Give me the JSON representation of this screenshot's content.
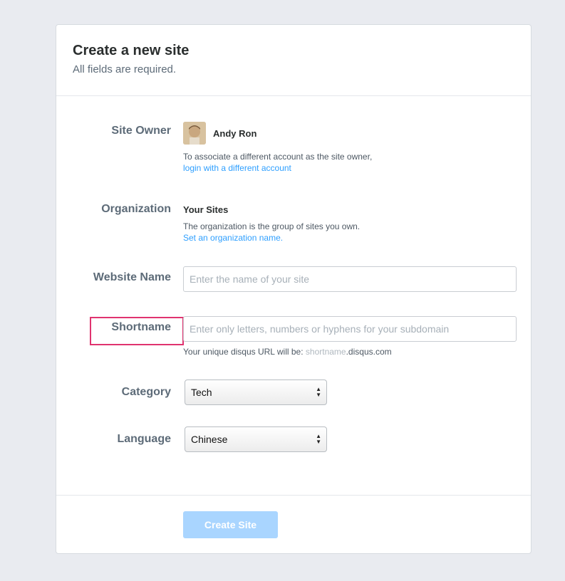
{
  "header": {
    "title": "Create a new site",
    "subtitle": "All fields are required."
  },
  "site_owner": {
    "label": "Site Owner",
    "name": "Andy Ron",
    "help": "To associate a different account as the site owner,",
    "link": "login with a different account"
  },
  "organization": {
    "label": "Organization",
    "name": "Your Sites",
    "help": "The organization is the group of sites you own.",
    "link": "Set an organization name."
  },
  "website_name": {
    "label": "Website Name",
    "value": "",
    "placeholder": "Enter the name of your site"
  },
  "shortname": {
    "label": "Shortname",
    "value": "",
    "placeholder": "Enter only letters, numbers or hyphens for your subdomain",
    "url_prefix": "Your unique disqus URL will be: ",
    "url_placeholder": "shortname",
    "url_suffix": ".disqus.com",
    "highlight_color": "#e0336f"
  },
  "category": {
    "label": "Category",
    "selected": "Tech"
  },
  "language": {
    "label": "Language",
    "selected": "Chinese"
  },
  "submit": {
    "label": "Create Site"
  },
  "colors": {
    "link": "#2e9fff",
    "button_disabled": "#a9d5ff",
    "background": "#e9ebf0"
  }
}
